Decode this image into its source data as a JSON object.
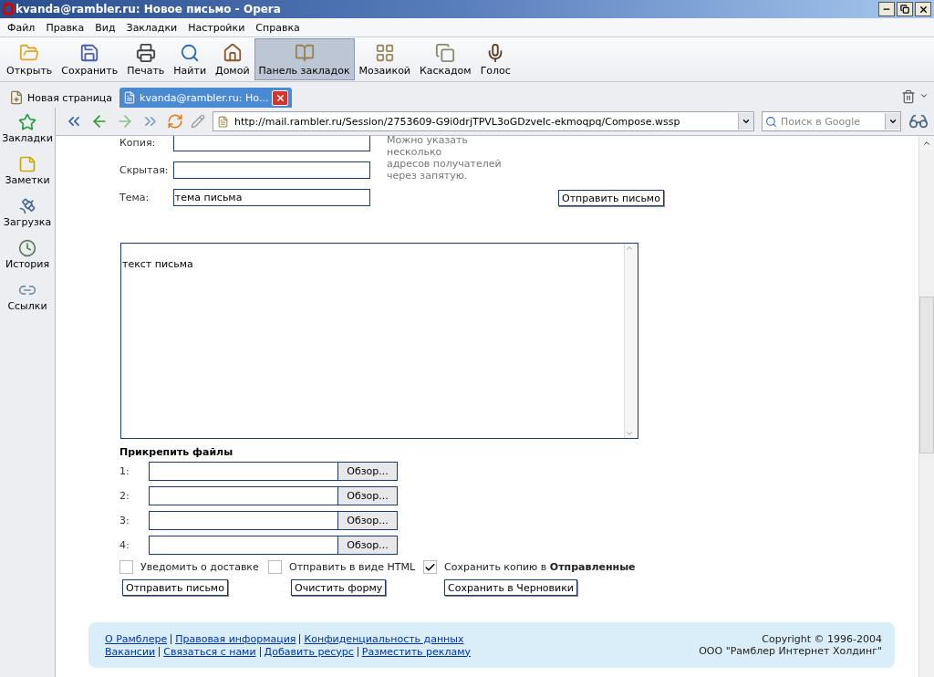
{
  "window": {
    "title": "kvanda@rambler.ru: Новое письмо - Opera"
  },
  "menu": [
    "Файл",
    "Правка",
    "Вид",
    "Закладки",
    "Настройки",
    "Справка"
  ],
  "toolbar": [
    {
      "kind": "open",
      "label": "Открыть",
      "selected": false
    },
    {
      "kind": "save",
      "label": "Сохранить",
      "selected": false
    },
    {
      "kind": "print",
      "label": "Печать",
      "selected": false
    },
    {
      "kind": "find",
      "label": "Найти",
      "selected": false
    },
    {
      "kind": "home",
      "label": "Домой",
      "selected": false
    },
    {
      "kind": "bookmarks",
      "label": "Панель закладок",
      "selected": true
    },
    {
      "kind": "tile",
      "label": "Мозаикой",
      "selected": false
    },
    {
      "kind": "cascade",
      "label": "Каскадом",
      "selected": false
    },
    {
      "kind": "voice",
      "label": "Голос",
      "selected": false
    }
  ],
  "tabs": [
    {
      "kind": "new",
      "label": "Новая страница",
      "selected": false
    },
    {
      "kind": "page",
      "label": "kvanda@rambler.ru: Но...",
      "selected": true
    }
  ],
  "address": {
    "url": "http://mail.rambler.ru/Session/2753609-G9i0drjTPVL3oGDzveIc-ekmoqpq/Compose.wssp",
    "search_placeholder": "Поиск в Google"
  },
  "sidebar": [
    {
      "kind": "bookmarks",
      "label": "Закладки"
    },
    {
      "kind": "notes",
      "label": "Заметки"
    },
    {
      "kind": "downloads",
      "label": "Загрузка"
    },
    {
      "kind": "history",
      "label": "История"
    },
    {
      "kind": "links",
      "label": "Ссылки"
    }
  ],
  "form": {
    "fields": [
      {
        "label": "Копия:"
      },
      {
        "label": "Скрытая:"
      },
      {
        "label": "Тема:",
        "value": "тема письма"
      }
    ],
    "hint": [
      "Можно указать",
      "несколько",
      "адресов получателей",
      "через запятую."
    ],
    "send_button": "Отправить письмо",
    "body": "текст письма",
    "attach_title": "Прикрепить файлы",
    "attachments": [
      {
        "label": "1:",
        "button": "Обзор..."
      },
      {
        "label": "2:",
        "button": "Обзор..."
      },
      {
        "label": "3:",
        "button": "Обзор..."
      },
      {
        "label": "4:",
        "button": "Обзор..."
      }
    ],
    "options": [
      {
        "label": "Уведомить о доставке",
        "checked": false
      },
      {
        "label": "Отправить в виде HTML",
        "checked": false
      },
      {
        "label": "Сохранить копию в **Отправленные**",
        "checked": true
      }
    ],
    "buttons": [
      "Отправить письмо",
      "Очистить форму",
      "Сохранить в Черновики"
    ]
  },
  "footer": {
    "link_rows": [
      [
        "О Рамблере",
        "Правовая информация",
        "Конфиденциальность данных"
      ],
      [
        "Вакансии",
        "Связаться с нами",
        "Добавить ресурс",
        "Разместить рекламу"
      ]
    ],
    "copyright": [
      "Copyright © 1996-2004",
      "ООО \"Рамблер Интернет Холдинг\""
    ]
  }
}
